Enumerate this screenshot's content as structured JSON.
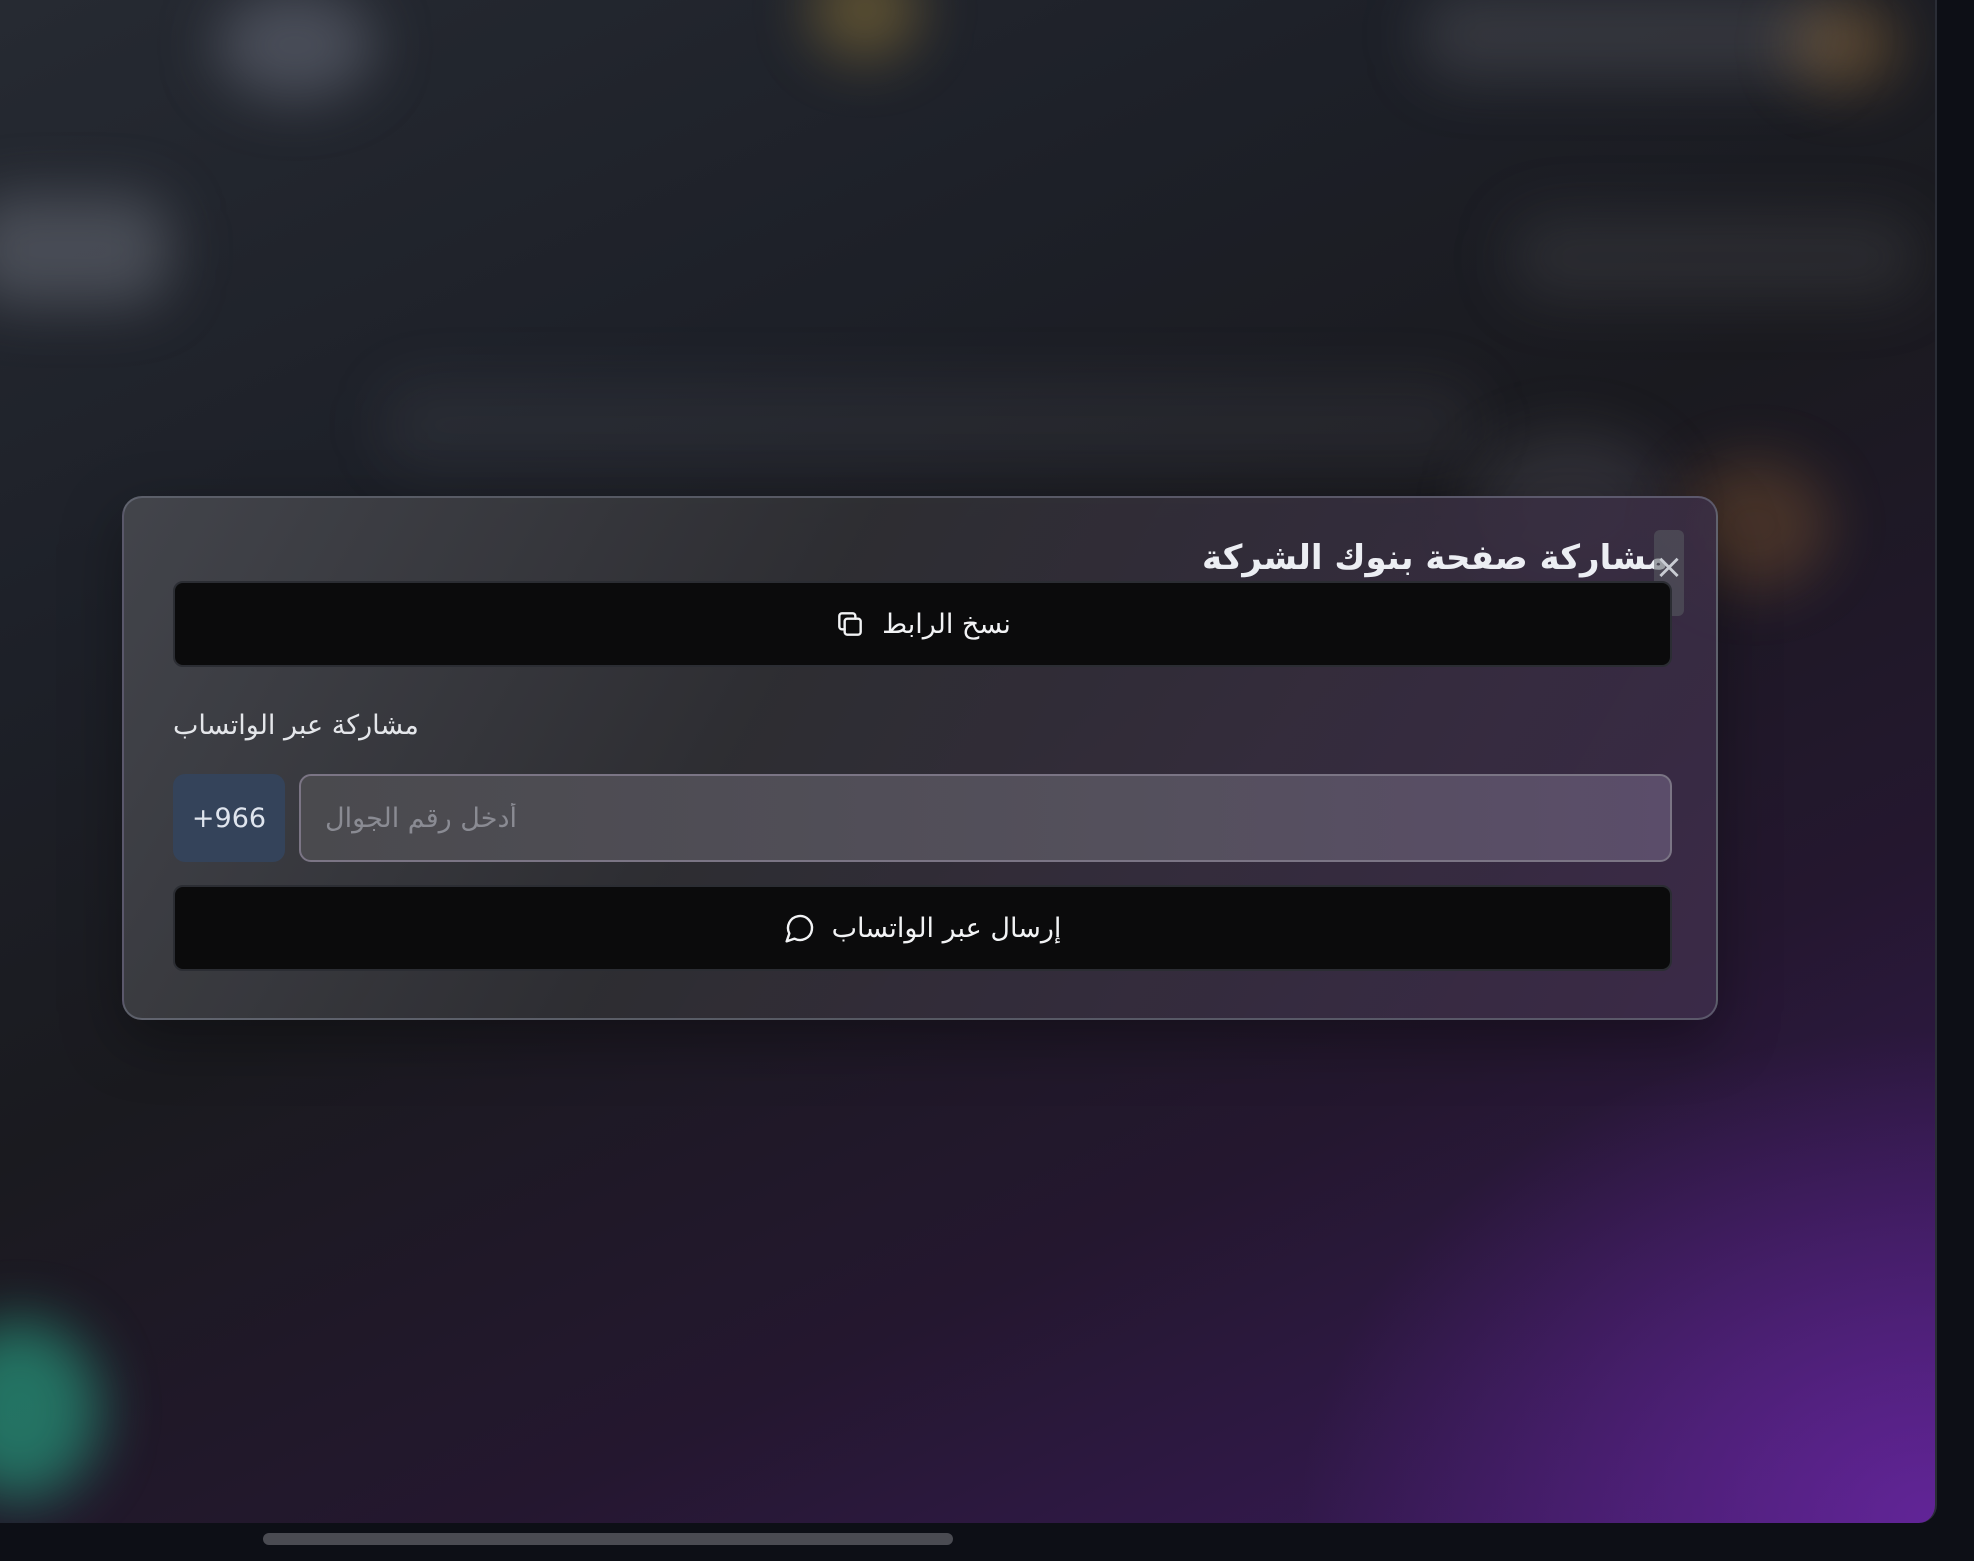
{
  "dialog": {
    "title": "مشاركة صفحة بنوك الشركة",
    "close_symbol": "×",
    "copy_button": {
      "label": "نسخ الرابط",
      "icon": "copy-icon"
    },
    "whatsapp_section": {
      "label": "مشاركة عبر الواتساب",
      "country_code": "+966",
      "phone_placeholder": "أدخل رقم الجوال",
      "phone_value": "",
      "send_button": {
        "label": "إرسال عبر الواتساب",
        "icon": "chat-bubble-icon"
      }
    }
  },
  "colors": {
    "button_bg": "#0b0b0c",
    "country_code_bg": "#34435a",
    "background_accent": "#3b1a5e"
  }
}
